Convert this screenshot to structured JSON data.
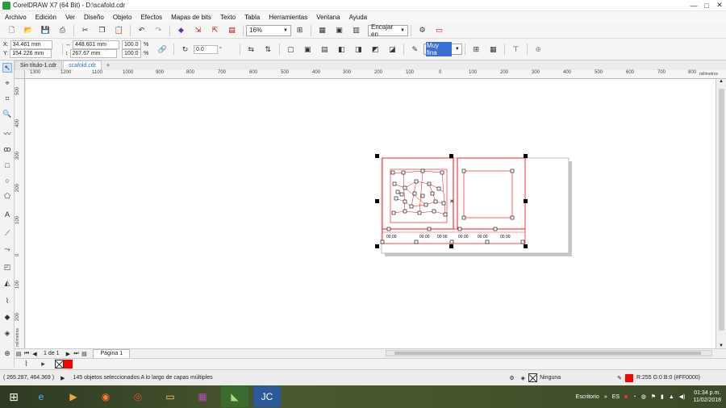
{
  "window": {
    "title": "CorelDRAW X7 (64 Bit) - D:\\scafold.cdr",
    "controls": {
      "minimize": "—",
      "maximize": "□",
      "close": "✕"
    }
  },
  "menu": [
    "Archivo",
    "Edición",
    "Ver",
    "Diseño",
    "Objeto",
    "Efectos",
    "Mapas de bits",
    "Texto",
    "Tabla",
    "Herramientas",
    "Ventana",
    "Ayuda"
  ],
  "toolbar1": {
    "zoom_value": "16%",
    "snap_label": "Encajar en"
  },
  "propbar": {
    "x_label": "X:",
    "x_value": "34.461 mm",
    "y_label": "Y:",
    "y_value": "154.226 mm",
    "w_value": "448.601 mm",
    "h_value": "267.67 mm",
    "scale_w": "100.0",
    "scale_h": "100.0",
    "percent": "%",
    "rotation": "0.0",
    "degree": "°",
    "outline_width": "Muy fina"
  },
  "doctabs": [
    "Sin título-1.cdr",
    "scafold.cdr"
  ],
  "ruler": {
    "h_ticks": [
      "1300",
      "1200",
      "1100",
      "1000",
      "900",
      "800",
      "700",
      "600",
      "500",
      "400",
      "300",
      "200",
      "100",
      "0",
      "100",
      "200",
      "300",
      "400",
      "500",
      "600",
      "700",
      "800"
    ],
    "h_unit": "milímetros",
    "v_ticks": [
      "500",
      "400",
      "300",
      "200",
      "100",
      "0",
      "100",
      "200"
    ],
    "v_unit": "milímetros"
  },
  "pagebar": {
    "page_count": "1 de 1",
    "page_tab": "Página 1"
  },
  "status": {
    "coords": "( 265.287, 464.369 )",
    "message": "145 objetos seleccionados A lo largo de capas múltiples",
    "fill_label": "Ninguna",
    "outline_label": "R:255 G:0 B:0 (#FF0000)",
    "outline_color": "#FF0000"
  },
  "taskbar": {
    "desktop_label": "Escritorio",
    "lang": "ES",
    "time": "01:34 p.m.",
    "date": "11/02/2018"
  }
}
